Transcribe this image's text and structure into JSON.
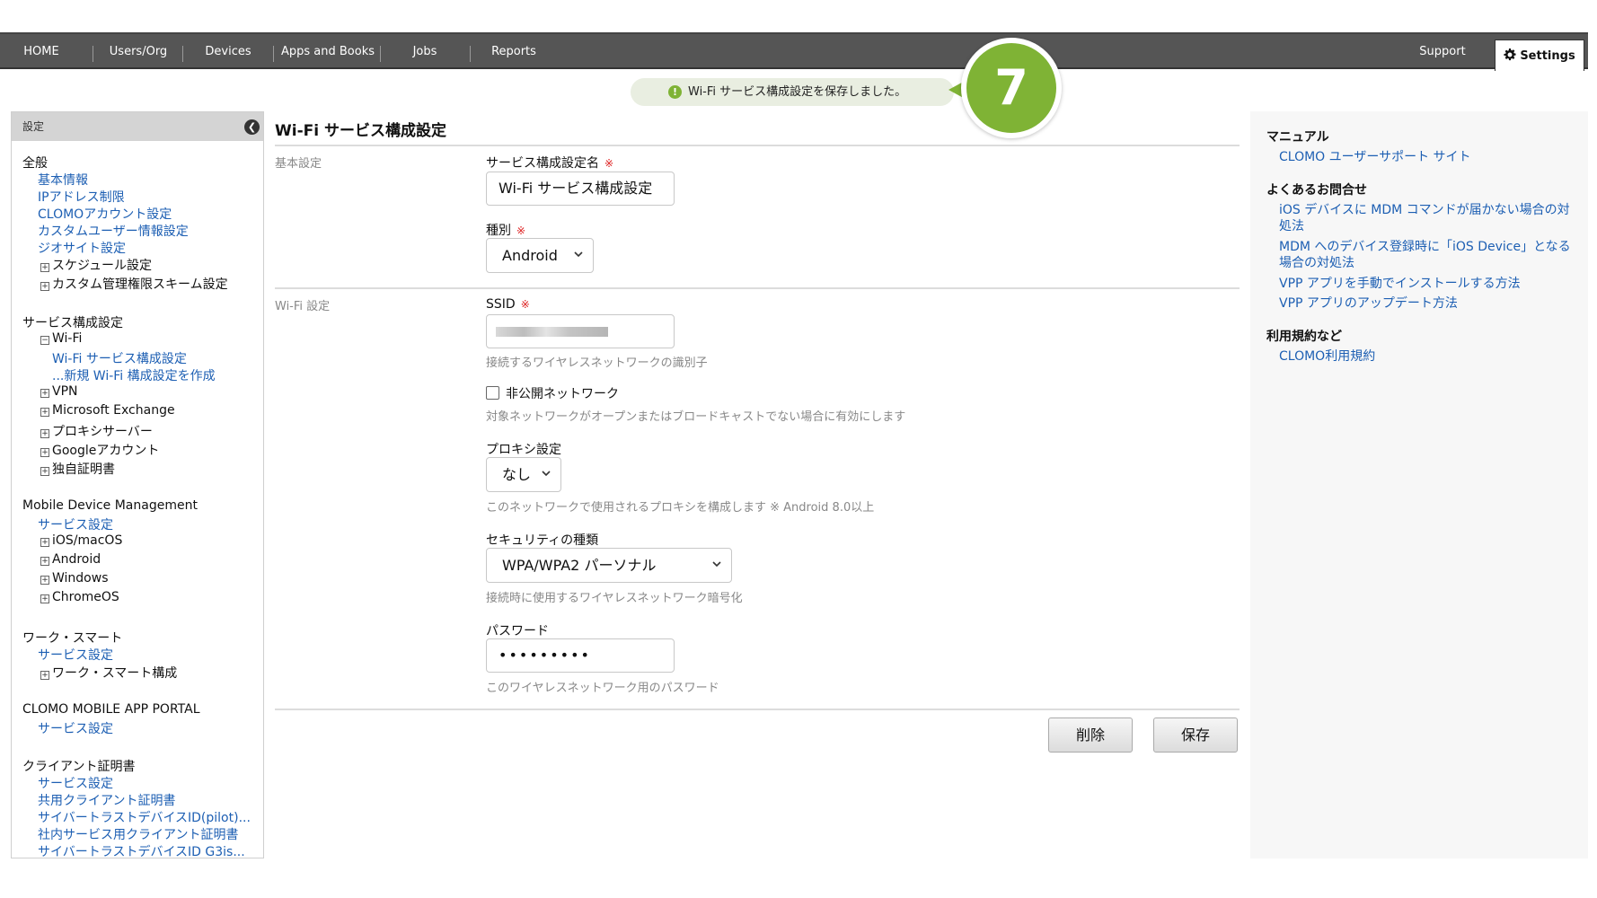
{
  "nav": {
    "items": [
      "HOME",
      "Users/Org",
      "Devices",
      "Apps and Books",
      "Jobs",
      "Reports"
    ],
    "support": "Support",
    "settings": "Settings"
  },
  "flash": {
    "icon": "exclamation-icon",
    "message": "Wi-Fi サービス構成設定を保存しました。"
  },
  "step_badge": "7",
  "sidebar": {
    "title": "設定",
    "sections": [
      {
        "title": "全般",
        "links": [
          "基本情報",
          "IPアドレス制限",
          "CLOMOアカウント設定",
          "カスタムユーザー情報設定",
          "ジオサイト設定"
        ],
        "tree": [
          "スケジュール設定",
          "カスタム管理権限スキーム設定"
        ]
      },
      {
        "title": "サービス構成設定",
        "wifi": "Wi-Fi",
        "wifi_links": [
          "Wi-Fi サービス構成設定",
          "...新規 Wi-Fi 構成設定を作成"
        ],
        "tree": [
          "VPN",
          "Microsoft Exchange",
          "プロキシサーバー",
          "Googleアカウント",
          "独自証明書"
        ]
      },
      {
        "title": "Mobile Device Management",
        "links": [
          "サービス設定"
        ],
        "tree": [
          "iOS/macOS",
          "Android",
          "Windows",
          "ChromeOS"
        ]
      },
      {
        "title": "ワーク・スマート",
        "links": [
          "サービス設定"
        ],
        "tree": [
          "ワーク・スマート構成"
        ]
      },
      {
        "title": "CLOMO MOBILE APP PORTAL",
        "links": [
          "サービス設定"
        ]
      },
      {
        "title": "クライアント証明書",
        "links": [
          "サービス設定",
          "共用クライアント証明書",
          "サイバートラストデバイスID(pilot)...",
          "社内サービス用クライアント証明書",
          "サイバートラストデバイスID G3is..."
        ]
      }
    ]
  },
  "main": {
    "title": "Wi-Fi サービス構成設定",
    "basic_group": "基本設定",
    "wifi_group": "Wi-Fi 設定",
    "required_mark": "※",
    "name_label": "サービス構成設定名",
    "name_value": "Wi-Fi サービス構成設定",
    "type_label": "種別",
    "type_value": "Android",
    "ssid_label": "SSID",
    "ssid_help": "接続するワイヤレスネットワークの識別子",
    "hidden_label": "非公開ネットワーク",
    "hidden_checked": false,
    "hidden_help": "対象ネットワークがオープンまたはブロードキャストでない場合に有効にします",
    "proxy_label": "プロキシ設定",
    "proxy_value": "なし",
    "proxy_help": "このネットワークで使用されるプロキシを構成します ※ Android 8.0以上",
    "security_label": "セキュリティの種類",
    "security_value": "WPA/WPA2 パーソナル",
    "security_help": "接続時に使用するワイヤレスネットワーク暗号化",
    "password_label": "パスワード",
    "password_value": "•••••••••",
    "password_help": "このワイヤレスネットワーク用のパスワード",
    "delete_button": "削除",
    "save_button": "保存"
  },
  "right": {
    "manual_title": "マニュアル",
    "manual_links": [
      "CLOMO ユーザーサポート サイト"
    ],
    "faq_title": "よくあるお問合せ",
    "faq_links": [
      "iOS デバイスに MDM コマンドが届かない場合の対処法",
      "MDM へのデバイス登録時に「iOS Device」となる場合の対処法",
      "VPP アプリを手動でインストールする方法",
      "VPP アプリのアップデート方法"
    ],
    "terms_title": "利用規約など",
    "terms_links": [
      "CLOMO利用規約"
    ]
  },
  "colors": {
    "nav_bg": "#555555",
    "link": "#1d5fb3",
    "accent_green": "#7fb335",
    "required": "#dd2222"
  }
}
